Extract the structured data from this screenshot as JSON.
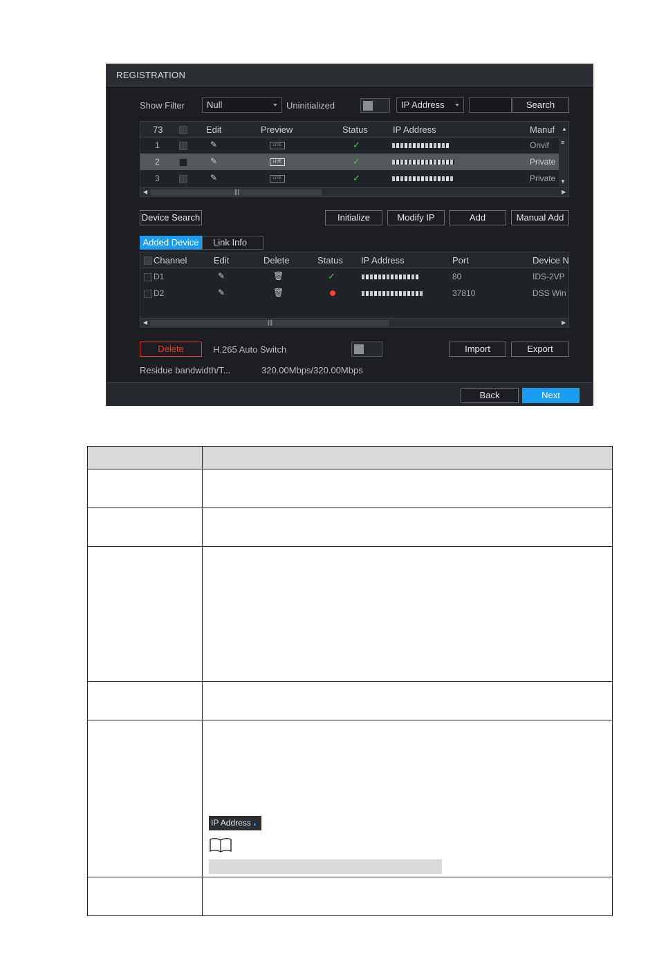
{
  "dialog": {
    "title": "REGISTRATION",
    "filter": {
      "show_filter_label": "Show Filter",
      "show_filter_value": "Null",
      "uninitialized_label": "Uninitialized",
      "ip_select_value": "IP Address",
      "search_input_value": "",
      "search_button": "Search"
    },
    "search_table": {
      "count": "73",
      "headers": [
        "Edit",
        "Preview",
        "Status",
        "IP Address",
        "Manuf"
      ],
      "rows": [
        {
          "num": "1",
          "manuf": "Onvif"
        },
        {
          "num": "2",
          "manuf": "Private"
        },
        {
          "num": "3",
          "manuf": "Private"
        }
      ]
    },
    "actions": {
      "device_search": "Device Search",
      "initialize": "Initialize",
      "modify_ip": "Modify IP",
      "add": "Add",
      "manual_add": "Manual Add"
    },
    "tabs": {
      "added_device": "Added Device",
      "link_info": "Link Info"
    },
    "added_table": {
      "headers": [
        "Channel",
        "Edit",
        "Delete",
        "Status",
        "IP Address",
        "Port",
        "Device N"
      ],
      "rows": [
        {
          "channel": "D1",
          "port": "80",
          "device": "IDS-2VP"
        },
        {
          "channel": "D2",
          "port": "37810",
          "device": "DSS Win"
        }
      ]
    },
    "bottom": {
      "delete": "Delete",
      "h265_label": "H.265 Auto Switch",
      "import": "Import",
      "export": "Export",
      "residue_label": "Residue bandwidth/T...",
      "residue_value": "320.00Mbps/320.00Mbps"
    },
    "footer": {
      "back": "Back",
      "next": "Next"
    }
  },
  "doc": {
    "ip_address_chip": "IP Address"
  },
  "colors": {
    "accent": "#1a9cf0",
    "ok_green": "#4fc24f",
    "error_red": "#ff3b3b",
    "delete_red": "#e53935"
  }
}
